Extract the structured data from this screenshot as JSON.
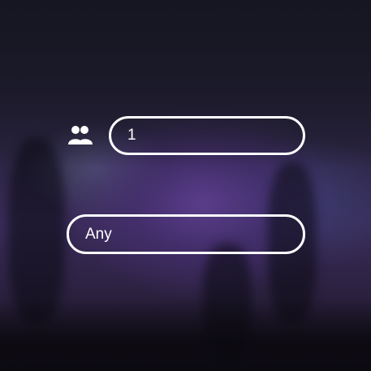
{
  "guests": {
    "icon": "people-icon",
    "value": "1"
  },
  "filter": {
    "value": "Any"
  },
  "colors": {
    "field_border": "#ffffff",
    "text": "#ffffff",
    "background_accent": "#5a3d8a"
  }
}
